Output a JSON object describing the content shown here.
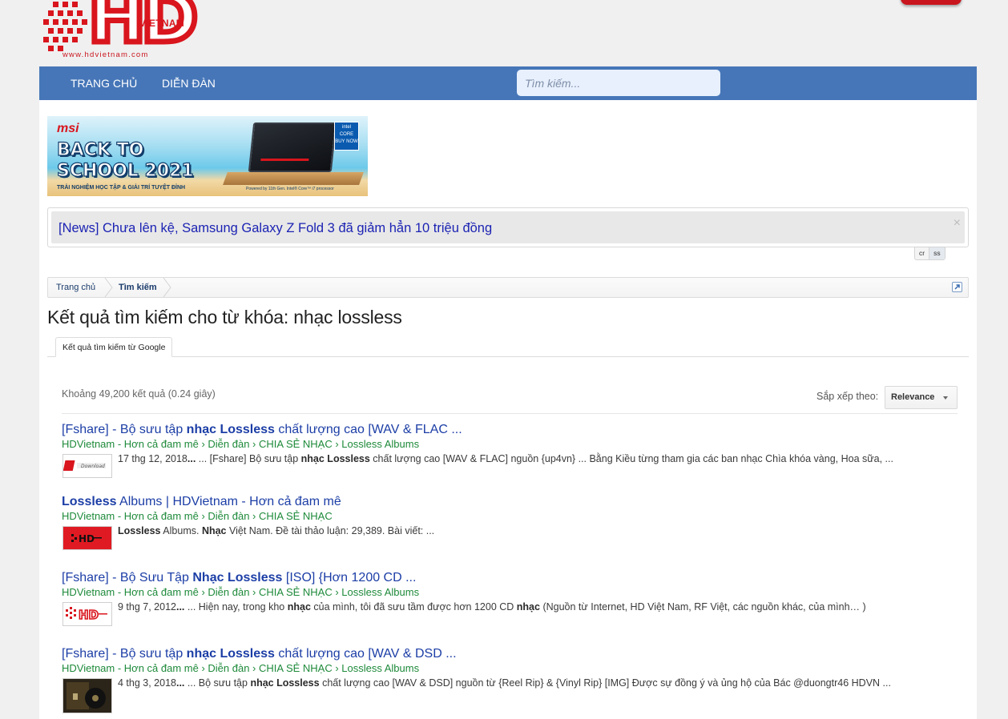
{
  "header": {
    "logo_text": "HD",
    "logo_country": "VIETNAM",
    "logo_url": "www.hdvietnam.com"
  },
  "nav": {
    "home": "TRANG CHỦ",
    "forum": "DIỄN ĐÀN",
    "search_placeholder": "Tìm kiếm..."
  },
  "banner": {
    "brand": "msi",
    "headline_1": "BACK TO",
    "headline_2": "SCHOOL 2021",
    "subline": "TRẢI NGHIỆM HỌC TẬP & GIẢI TRÍ TUYỆT ĐỈNH",
    "badge_1": "intel",
    "badge_2": "CORE",
    "badge_3": "BUY NOW",
    "powered": "Powered by 11th Gen. Intel® Core™ i7 processor"
  },
  "notice": {
    "text": "[News] Chưa lên kệ, Samsung Galaxy Z Fold 3 đã giảm hẳn 10 triệu đồng",
    "close": "×"
  },
  "lang_tabs": [
    "cr",
    "ss"
  ],
  "breadcrumb": {
    "home": "Trang chủ",
    "search": "Tìm kiếm"
  },
  "page_title": "Kết quả tìm kiếm cho từ khóa: nhạc lossless",
  "tab_label": "Kết quả tìm kiếm từ Google",
  "results_meta": {
    "stats": "Khoảng 49,200 kết quả (0.24 giây)",
    "sort_label": "Sắp xếp theo:",
    "sort_value": "Relevance"
  },
  "results": [
    {
      "title_pre": "[Fshare] - Bộ sưu tập ",
      "title_bold": "nhạc Lossless",
      "title_post": " chất lượng cao [WAV & FLAC ...",
      "url": "HDVietnam - Hơn cả đam mê › Diễn đàn › CHIA SẺ NHẠC › Lossless Albums",
      "date": "17 thg 12, 2018",
      "snippet_a": " ... [Fshare] Bộ sưu tập ",
      "snippet_b": "nhạc Lossless",
      "snippet_c": " chất lượng cao [WAV & FLAC] nguồn {up4vn} ... Bằng Kiều từng tham gia các ban nhạc Chìa khóa vàng, Hoa sữa, ..."
    },
    {
      "title_pre": "",
      "title_bold": "Lossless",
      "title_post": " Albums | HDVietnam - Hơn cả đam mê",
      "url": "HDVietnam - Hơn cả đam mê › Diễn đàn › CHIA SẺ NHẠC",
      "date": "",
      "snippet_a": "",
      "snippet_b": "Lossless",
      "snippet_c": " Albums. ",
      "snippet_d": "Nhạc",
      "snippet_e": " Việt Nam. Đề tài thảo luận: 29,389. Bài viết: ..."
    },
    {
      "title_pre": "[Fshare] - Bộ Sưu Tập ",
      "title_bold": "Nhạc Lossless",
      "title_post": " [ISO] {Hơn 1200 CD ...",
      "url": "HDVietnam - Hơn cả đam mê › Diễn đàn › CHIA SẺ NHẠC › Lossless Albums",
      "date": "9 thg 7, 2012",
      "snippet_a": " ... Hiện nay, trong kho ",
      "snippet_b": "nhạc",
      "snippet_c": " của mình, tôi đã sưu tầm được hơn 1200 CD ",
      "snippet_d": "nhạc",
      "snippet_e": " (Nguồn từ Internet, HD Việt Nam, RF Việt, các nguồn khác, của mình… )"
    },
    {
      "title_pre": "[Fshare] - Bộ sưu tập ",
      "title_bold": "nhạc Lossless",
      "title_post": " chất lượng cao [WAV & DSD ...",
      "url": "HDVietnam - Hơn cả đam mê › Diễn đàn › CHIA SẺ NHẠC › Lossless Albums",
      "date": "4 thg 3, 2018",
      "snippet_a": " ... Bộ sưu tập ",
      "snippet_b": "nhạc Lossless",
      "snippet_c": " chất lượng cao [WAV & DSD] nguồn từ {Reel Rip} & {Vinyl Rip} [IMG] Được sự đồng ý và ủng hộ của Bác @duongtr46 HDVN ..."
    }
  ],
  "colors": {
    "nav_bg": "#4676b8",
    "brand_red": "#d9151d",
    "link": "#1c3ea6",
    "url_green": "#1e8a3a"
  }
}
